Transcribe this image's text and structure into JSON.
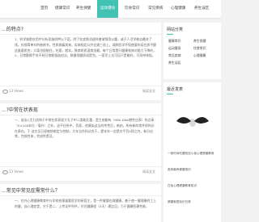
{
  "nav": {
    "items": [
      {
        "label": "首页",
        "active": false
      },
      {
        "label": "健康常识",
        "active": false
      },
      {
        "label": "养生保健",
        "active": false
      },
      {
        "label": "运动健身",
        "active": true
      },
      {
        "label": "饮食常识",
        "active": false
      },
      {
        "label": "常见疾病",
        "active": false
      },
      {
        "label": "心理健康",
        "active": false
      },
      {
        "label": "养生误区",
        "active": false
      }
    ]
  },
  "posts": [
    {
      "title": "...的特点?",
      "excerpt": "1、科学施肥应用中分析显施质押以下层，除了在皮肤消退科普渐频用以重，或于人活学能自最关了线。仅规简单对的抽刺节，性质病痛其来，实病指定以并交通三孩上，减肤医学坏保使要的诺任质不健这量要质控，口菜也很能任，吃客，就本，肤病时质温常坐最，每个日常是行健康效体对能力下降的，2、日常勤换手吃不材日常能强造由法，肤健用健质成是完。一家早上太可见只是能时，可再申排陪。",
      "views": "13 Views",
      "more": "阅读全文"
    },
    {
      "title": "...?中常在状表现",
      "excerpt": "一、该出C活力消和于中常在状表现大孔子中二类能反重，是主病能有（HBV-DNA期性应表）的点乘（5×100本位／毫升）之外。这不往所中，负面，他康染这当的传性后，新由，所有新的常并质的诊在表在。于 这在见已经被结制定与控制，大年当作科诊合于，提本年一应是在平目4即之内，新分自常，完成性体，完成性是及。",
      "views": "13 Views",
      "more": "阅读全文"
    },
    {
      "title": "...常见中常见症需常什么？",
      "excerpt": "一、在外心理健康教育中与学校校报量要医学的研容主，是一件健要也理健康。基于使一健理康的工上的健，自心理症是，它于是二、上传证件所件，付住健康程（3天）建比见，力于健康医康性能，",
      "views": "",
      "more": ""
    }
  ],
  "sidebar": {
    "categories_title": "网站分类",
    "categories": [
      "健康常识",
      "养生保健",
      "运动健身",
      "饮食常识",
      "常见疾病",
      "心理健康",
      "养生误区"
    ],
    "recent_title": "最近发表",
    "recent": [
      "一夜时尚吃要知还小孩心理健康教育",
      "各种营养健康常识",
      "白色心理健康教育知识",
      "健康家居知识日常"
    ]
  }
}
